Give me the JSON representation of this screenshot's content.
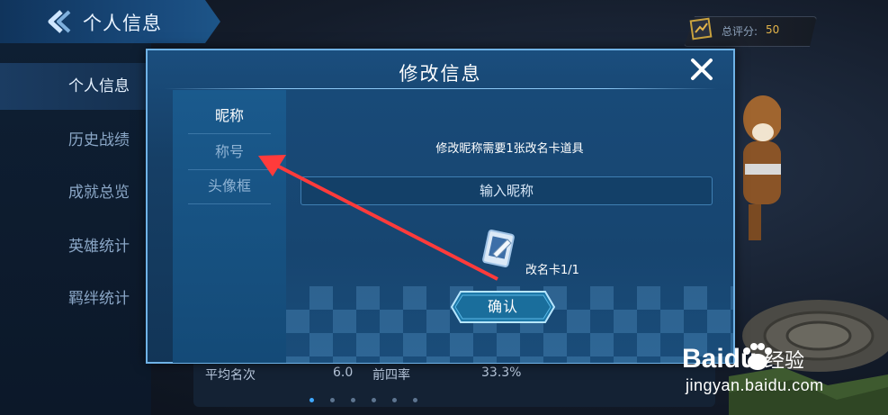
{
  "background": {
    "header_title": "个人信息",
    "sidebar": [
      {
        "label": "个人信息",
        "active": true
      },
      {
        "label": "历史战绩",
        "active": false
      },
      {
        "label": "成就总览",
        "active": false
      },
      {
        "label": "英雄统计",
        "active": false
      },
      {
        "label": "羁绊统计",
        "active": false
      }
    ],
    "score": {
      "label": "总评分:",
      "value": "50"
    },
    "stats": {
      "avg_rank_label": "平均名次",
      "avg_rank_value": "6.0",
      "top4_label": "前四率",
      "top4_value": "33.3%"
    },
    "page_dots": 6,
    "page_dot_active": 0
  },
  "modal": {
    "title": "修改信息",
    "close_icon": "close-icon",
    "tabs": [
      {
        "label": "昵称",
        "active": true
      },
      {
        "label": "称号",
        "active": false
      },
      {
        "label": "头像框",
        "active": false
      }
    ],
    "hint": "修改昵称需要1张改名卡道具",
    "input_placeholder": "输入昵称",
    "item_icon": "rename-card-icon",
    "item_label": "改名卡1/1",
    "confirm_label": "确认"
  },
  "annotation": {
    "arrow_color": "#ff3b3b"
  },
  "watermark": {
    "brand": "经验",
    "url": "jingyan.baidu.com",
    "logo_text": "Baidu"
  },
  "colors": {
    "modal_border": "#6fb2e6",
    "score_value": "#e3b44a",
    "accent": "#3fa8ff"
  }
}
